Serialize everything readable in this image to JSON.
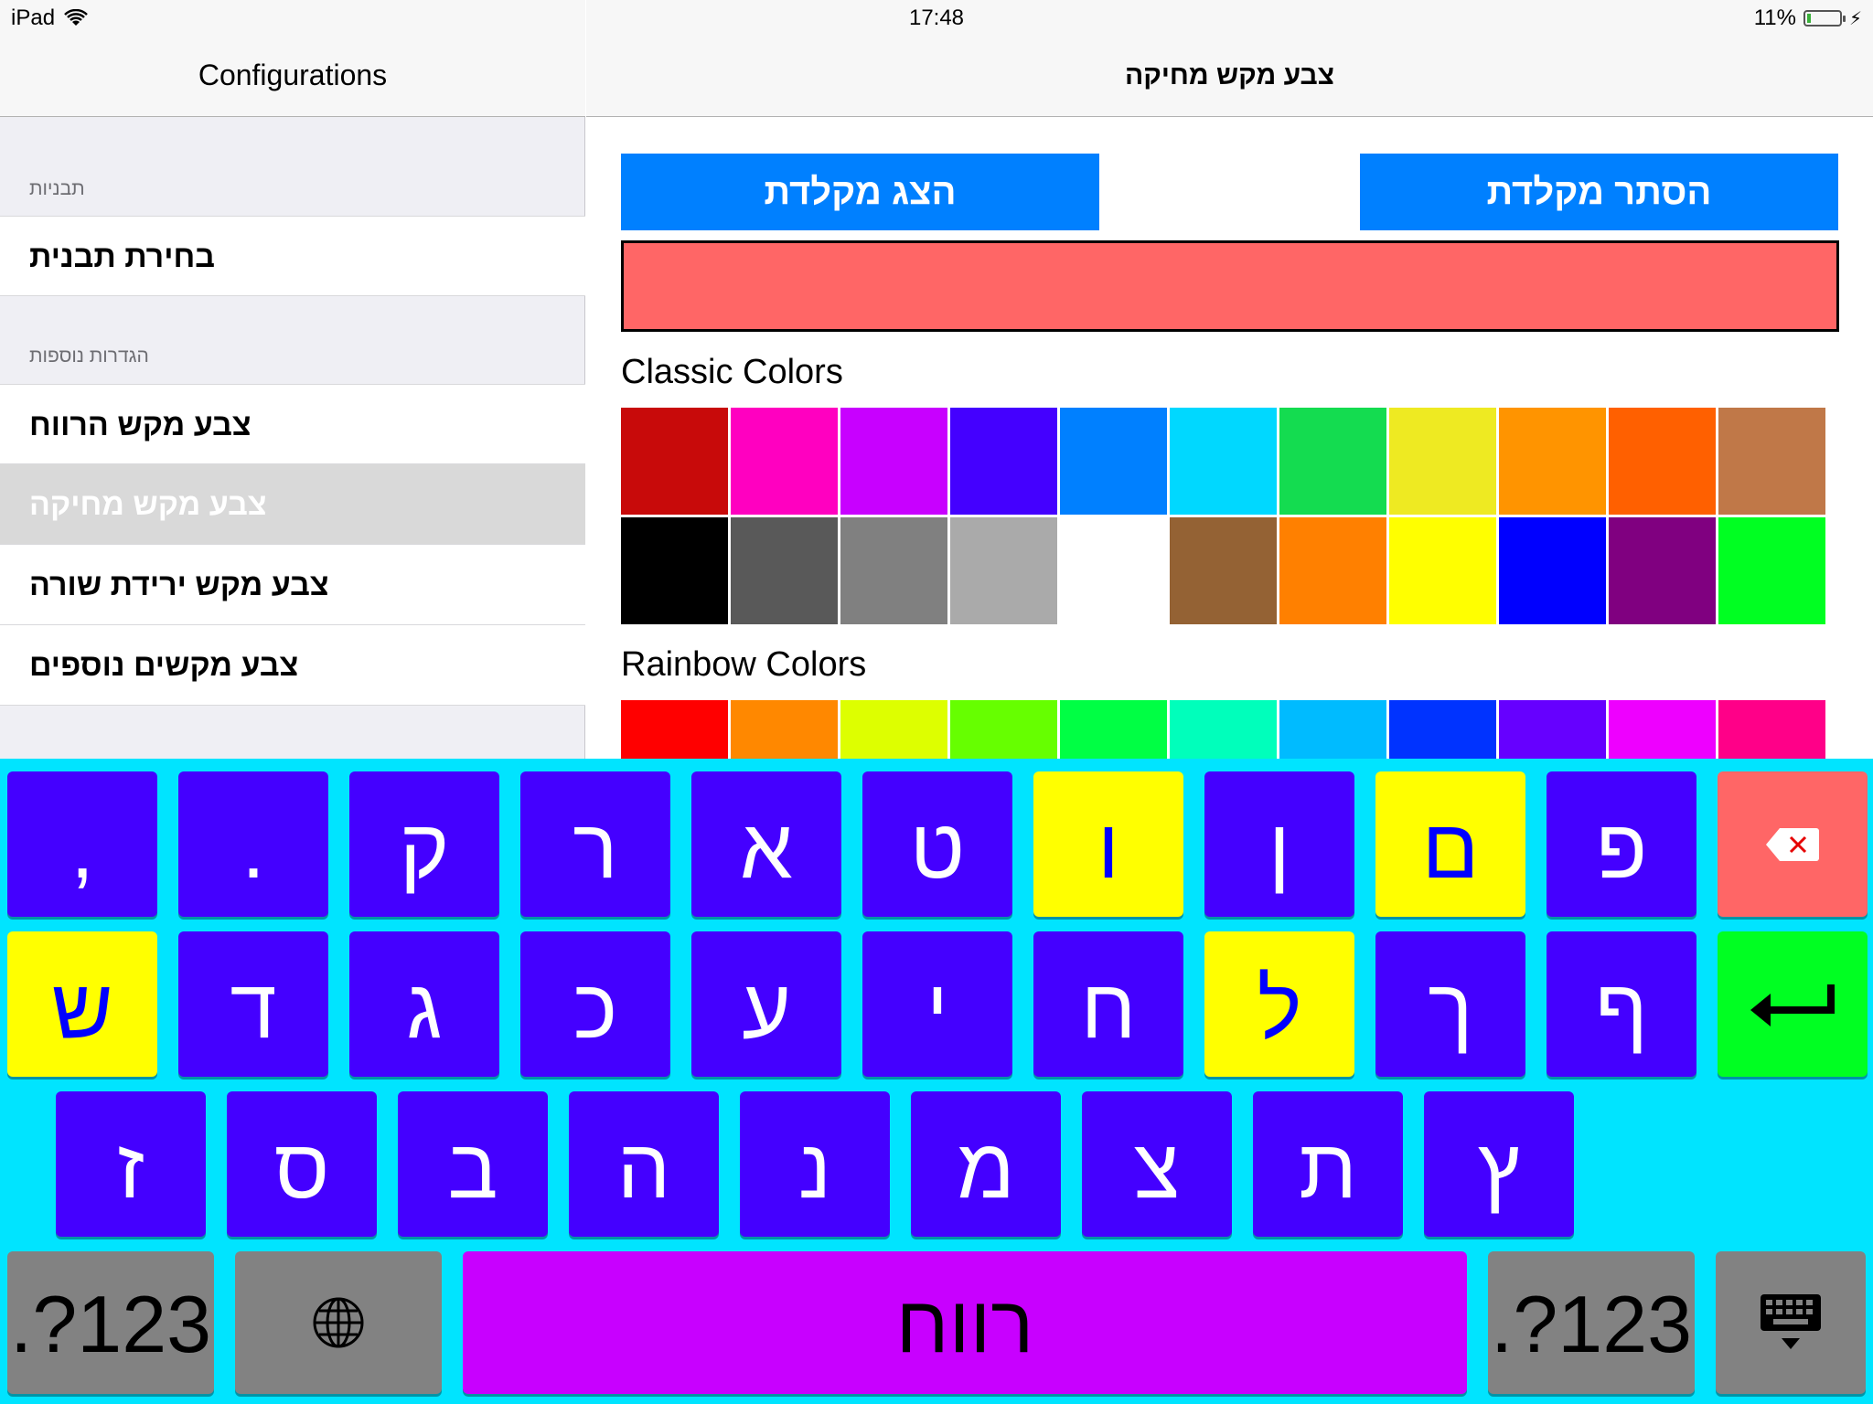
{
  "status_bar": {
    "device": "iPad",
    "time": "17:48",
    "battery": "11%",
    "battery_level": 0.11
  },
  "left_nav": {
    "title": "Configurations"
  },
  "sidebar": {
    "sections": [
      {
        "header": "תבניות",
        "items": [
          "בחירת תבנית"
        ]
      },
      {
        "header": "הגדרות נוספות",
        "items": [
          "צבע מקש הרווח",
          "צבע מקש מחיקה",
          "צבע מקש ירידת שורה",
          "צבע מקשים נוספים"
        ]
      }
    ],
    "selected_item": "צבע מקש מחיקה"
  },
  "right_nav": {
    "title": "צבע מקש מחיקה"
  },
  "buttons": {
    "hide_keyboard": "הסתר מקלדת",
    "show_keyboard": "הצג מקלדת"
  },
  "preview_color": "#ff6666",
  "classic": {
    "label": "Classic Colors",
    "colors": [
      "#c80a0a",
      "#ff00c0",
      "#c800ff",
      "#4400ff",
      "#0080ff",
      "#00d8ff",
      "#14dc50",
      "#eeea22",
      "#ff9400",
      "#ff6000",
      "#c07848",
      "#000000",
      "#595959",
      "#808080",
      "#aaaaaa",
      "#ffffff",
      "#946234",
      "#ff8000",
      "#ffff00",
      "#0000ff",
      "#800080",
      "#00ff22"
    ]
  },
  "rainbow": {
    "label": "Rainbow Colors",
    "colors": [
      "#ff0000",
      "#ff8800",
      "#ddff00",
      "#66ff00",
      "#00ff44",
      "#00ffbb",
      "#00bbff",
      "#0033ff",
      "#6600ff",
      "#ee00ff",
      "#ff0088"
    ]
  },
  "keyboard": {
    "row1": [
      "פ",
      "ם",
      "ן",
      "ו",
      "ט",
      "א",
      "ר",
      "ק",
      ".",
      ","
    ],
    "row2": [
      "ף",
      "ך",
      "ל",
      "ח",
      "י",
      "ע",
      "כ",
      "ג",
      "ד",
      "ש"
    ],
    "row3": [
      "ץ",
      "ת",
      "צ",
      "מ",
      "נ",
      "ה",
      "ב",
      "ס",
      "ז"
    ],
    "numbers_label": ".?123",
    "space_label": "רווח",
    "key_color": "#4400ff",
    "highlight_color": "#ffff00",
    "delete_color": "#ff6666",
    "return_color": "#00ff22",
    "space_color": "#c800ff",
    "background": "#00e4ff"
  }
}
